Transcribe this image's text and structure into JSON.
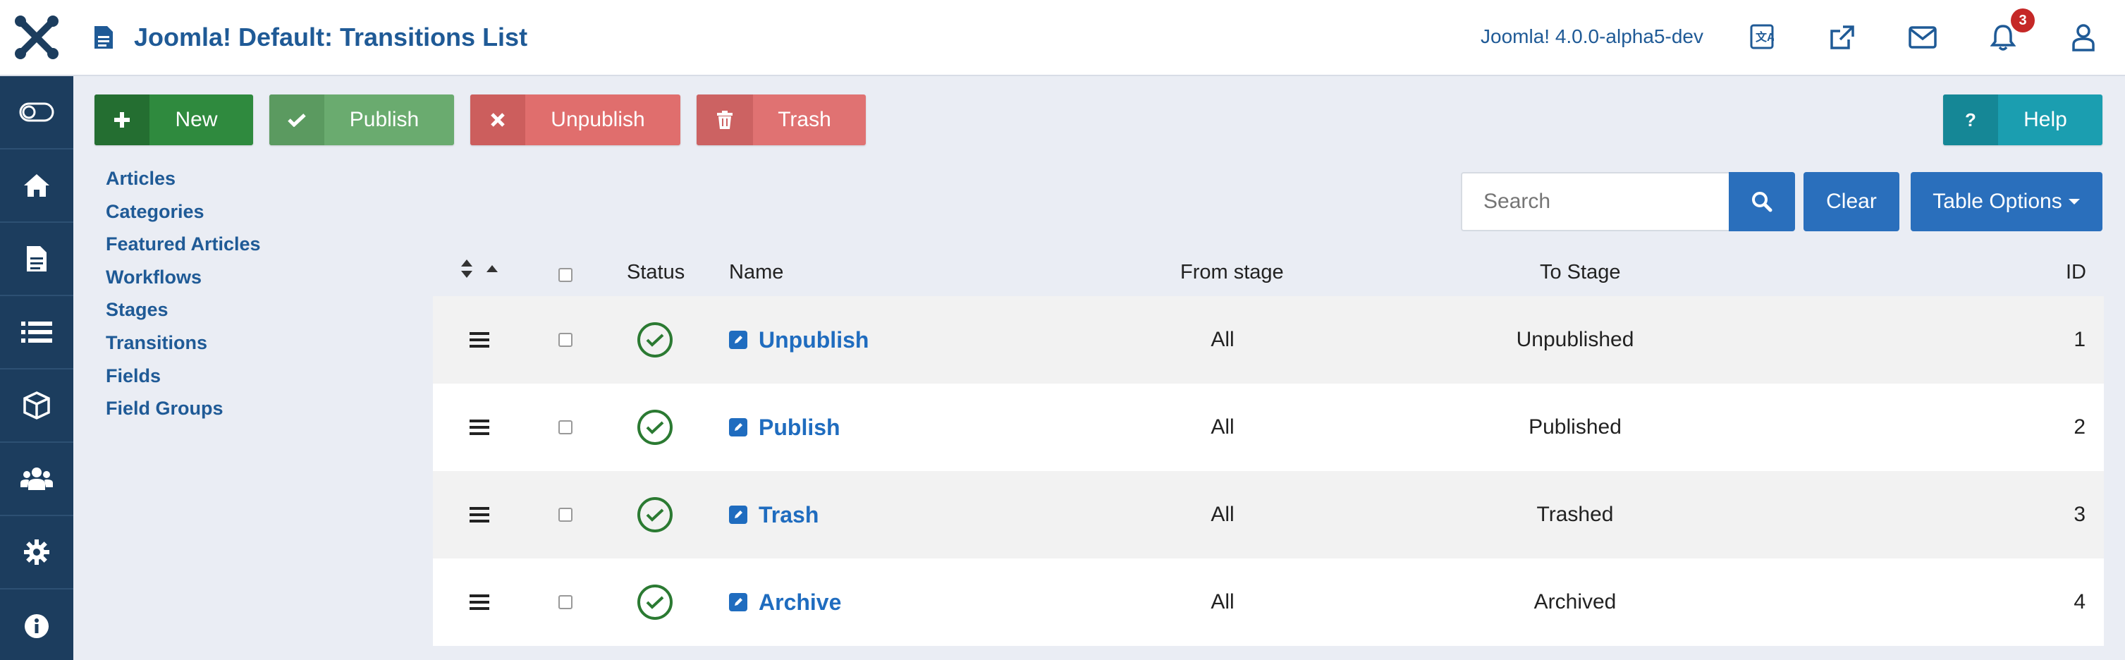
{
  "header": {
    "title": "Joomla! Default: Transitions List",
    "version": "Joomla! 4.0.0-alpha5-dev",
    "notifications_count": "3"
  },
  "toolbar": {
    "new_label": "New",
    "publish_label": "Publish",
    "unpublish_label": "Unpublish",
    "trash_label": "Trash",
    "help_label": "Help",
    "help_icon": "?"
  },
  "submenu": [
    "Articles",
    "Categories",
    "Featured Articles",
    "Workflows",
    "Stages",
    "Transitions",
    "Fields",
    "Field Groups"
  ],
  "filters": {
    "search_placeholder": "Search",
    "clear_label": "Clear",
    "table_options_label": "Table Options"
  },
  "table": {
    "headers": {
      "status": "Status",
      "name": "Name",
      "from_stage": "From stage",
      "to_stage": "To Stage",
      "id": "ID"
    },
    "rows": [
      {
        "name": "Unpublish",
        "from_stage": "All",
        "to_stage": "Unpublished",
        "id": "1"
      },
      {
        "name": "Publish",
        "from_stage": "All",
        "to_stage": "Published",
        "id": "2"
      },
      {
        "name": "Trash",
        "from_stage": "All",
        "to_stage": "Trashed",
        "id": "3"
      },
      {
        "name": "Archive",
        "from_stage": "All",
        "to_stage": "Archived",
        "id": "4"
      }
    ]
  },
  "colors": {
    "sidebar": "#1c3d5e",
    "accent": "#2a6fbc",
    "new": "#2f8a3e",
    "publish": "#6aab6f",
    "unpublish": "#e06e6d",
    "trash": "#e07272",
    "help": "#1b9eb0",
    "status_ok": "#2b7a32"
  }
}
